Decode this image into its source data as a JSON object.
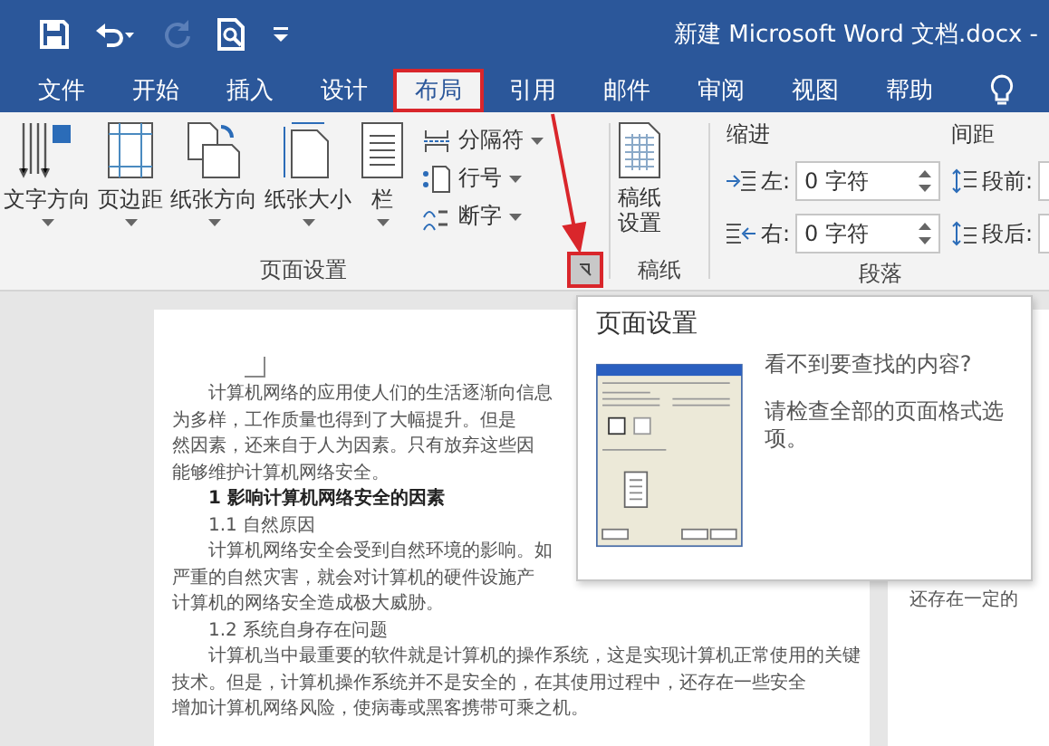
{
  "title_bar": {
    "title": "新建 Microsoft Word 文档.docx -",
    "quick_access": [
      {
        "kind": "save",
        "disabled": false
      },
      {
        "kind": "undo",
        "disabled": false
      },
      {
        "kind": "redo",
        "disabled": true
      },
      {
        "kind": "preview",
        "disabled": false
      },
      {
        "kind": "customize",
        "disabled": false
      }
    ]
  },
  "tabs": [
    {
      "label": "文件",
      "selected": false,
      "highlighted": false
    },
    {
      "label": "开始",
      "selected": false,
      "highlighted": false
    },
    {
      "label": "插入",
      "selected": false,
      "highlighted": false
    },
    {
      "label": "设计",
      "selected": false,
      "highlighted": false
    },
    {
      "label": "布局",
      "selected": true,
      "highlighted": true
    },
    {
      "label": "引用",
      "selected": false,
      "highlighted": false
    },
    {
      "label": "邮件",
      "selected": false,
      "highlighted": false
    },
    {
      "label": "审阅",
      "selected": false,
      "highlighted": false
    },
    {
      "label": "视图",
      "selected": false,
      "highlighted": false
    },
    {
      "label": "帮助",
      "selected": false,
      "highlighted": false
    }
  ],
  "page_setup": {
    "label": "页面设置",
    "launcher_highlighted": true,
    "large_buttons": [
      {
        "kind": "text_direction",
        "label": "文字方向"
      },
      {
        "kind": "margins",
        "label": "页边距"
      },
      {
        "kind": "orientation",
        "label": "纸张方向"
      },
      {
        "kind": "size",
        "label": "纸张大小"
      },
      {
        "kind": "columns",
        "label": "栏"
      }
    ],
    "small_buttons": [
      {
        "kind": "breaks",
        "label": "分隔符"
      },
      {
        "kind": "line_numbers",
        "label": "行号"
      },
      {
        "kind": "hyphenation",
        "label": "断字"
      }
    ]
  },
  "manuscript": {
    "label": "稿纸",
    "button": "稿纸设置"
  },
  "paragraph": {
    "label": "段落",
    "indent_title": "缩进",
    "spacing_title": "间距",
    "indent": [
      {
        "kind": "left",
        "label": "左:",
        "value": "0 字符"
      },
      {
        "kind": "right",
        "label": "右:",
        "value": "0 字符"
      }
    ],
    "spacing": [
      {
        "kind": "before",
        "label": "段前:"
      },
      {
        "kind": "after",
        "label": "段后:"
      }
    ]
  },
  "tooltip": {
    "title": "页面设置",
    "heading": "看不到要查找的内容?",
    "body": "请检查全部的页面格式选项。"
  },
  "document": {
    "left_page": [
      {
        "kind": "indent",
        "text": "计算机网络的应用使人们的生活逐渐向信息"
      },
      {
        "kind": "plain",
        "text": "为多样，工作质量也得到了大幅提升。但是"
      },
      {
        "kind": "plain",
        "text": "然因素，还来自于人为因素。只有放弃这些因"
      },
      {
        "kind": "plain",
        "text": "能够维护计算机网络安全。"
      },
      {
        "kind": "heading",
        "text": "1 影响计算机网络安全的因素"
      },
      {
        "kind": "indent",
        "text": "1.1 自然原因"
      },
      {
        "kind": "indent",
        "text": "计算机网络安全会受到自然环境的影响。如"
      },
      {
        "kind": "plain",
        "text": "严重的自然灾害，就会对计算机的硬件设施产"
      },
      {
        "kind": "plain",
        "text": "计算机的网络安全造成极大威胁。"
      },
      {
        "kind": "indent",
        "text": "1.2 系统自身存在问题"
      },
      {
        "kind": "indent",
        "text": "计算机当中最重要的软件就是计算机的操作系统，这是实现计算机正常使用的关键"
      },
      {
        "kind": "plain",
        "text": "技术。但是，计算机操作系统并不是安全的，在其使用过程中，还存在一些安全"
      },
      {
        "kind": "plain",
        "text": "增加计算机网络风险，使病毒或黑客携带可乘之机。"
      }
    ],
    "right_page": [
      {
        "text": "还存在一定的"
      }
    ]
  }
}
